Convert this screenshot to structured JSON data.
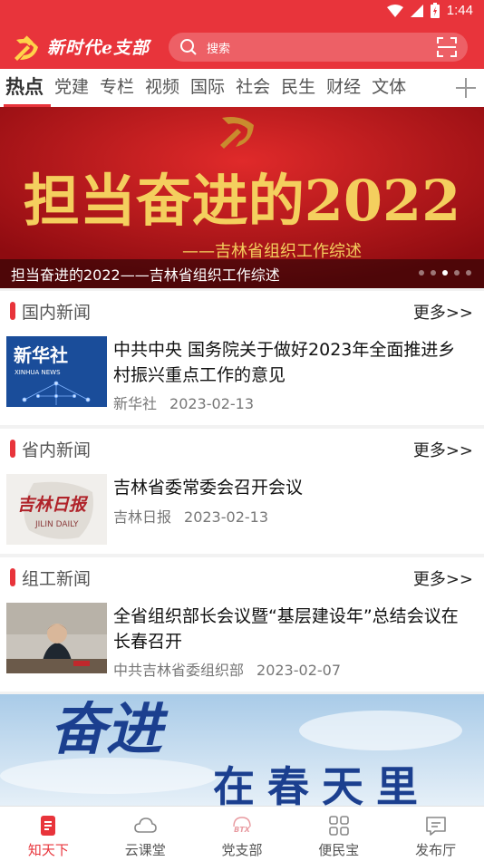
{
  "status_bar": {
    "time": "1:44"
  },
  "header": {
    "title": "新时代e支部",
    "search_placeholder": "搜索"
  },
  "tabs": [
    {
      "label": "热点",
      "active": true
    },
    {
      "label": "党建"
    },
    {
      "label": "专栏"
    },
    {
      "label": "视频"
    },
    {
      "label": "国际"
    },
    {
      "label": "社会"
    },
    {
      "label": "民生"
    },
    {
      "label": "财经"
    },
    {
      "label": "文体"
    }
  ],
  "banner": {
    "headline": "担当奋进的2022",
    "subline": "——吉林省组织工作综述",
    "caption": "担当奋进的2022——吉林省组织工作综述",
    "slide_count": 5,
    "active_slide": 3
  },
  "sections": [
    {
      "title": "国内新闻",
      "more": "更多>>",
      "item": {
        "title": "中共中央 国务院关于做好2023年全面推进乡村振兴重点工作的意见",
        "source": "新华社",
        "date": "2023-02-13",
        "thumb_text": "新华社",
        "thumb_sub": "XINHUA NEWS"
      }
    },
    {
      "title": "省内新闻",
      "more": "更多>>",
      "item": {
        "title": "吉林省委常委会召开会议",
        "source": "吉林日报",
        "date": "2023-02-13",
        "thumb_text": "吉林日报",
        "thumb_sub": "JILIN DAILY"
      }
    },
    {
      "title": "组工新闻",
      "more": "更多>>",
      "item": {
        "title": "全省组织部长会议暨“基层建设年”总结会议在长春召开",
        "source": "中共吉林省委组织部",
        "date": "2023-02-07"
      }
    }
  ],
  "promo": {
    "line1": "奋进",
    "line2": "在春天里"
  },
  "bottom_nav": [
    {
      "label": "知天下",
      "icon": "news-icon",
      "active": true
    },
    {
      "label": "云课堂",
      "icon": "cloud-icon"
    },
    {
      "label": "党支部",
      "icon": "btx-icon",
      "badge": "BTX"
    },
    {
      "label": "便民宝",
      "icon": "grid-icon"
    },
    {
      "label": "发布厅",
      "icon": "message-icon"
    }
  ],
  "colors": {
    "brand_red": "#e8343b",
    "banner_red": "#c0141c"
  }
}
